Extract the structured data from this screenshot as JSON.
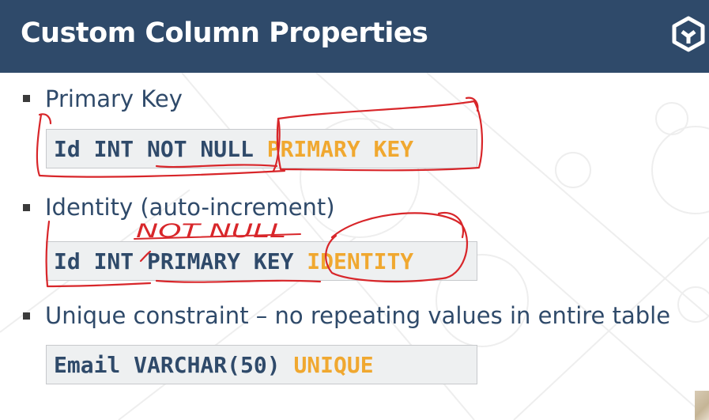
{
  "header": {
    "title": "Custom Column Properties",
    "logo_icon": "academy-logo-icon"
  },
  "bullets": [
    {
      "text": "Primary Key",
      "code_base": "Id INT NOT NULL ",
      "code_keyword": "PRIMARY KEY"
    },
    {
      "text": "Identity (auto-increment)",
      "code_base": "Id INT PRIMARY KEY ",
      "code_keyword": "IDENTITY"
    },
    {
      "text": "Unique constraint – no repeating values in entire table",
      "code_base": "Email VARCHAR(50) ",
      "code_keyword": "UNIQUE"
    }
  ],
  "annotation": {
    "handwritten_text": "NOT NULL"
  },
  "colors": {
    "header": "#2f4a6a",
    "keyword": "#f0a830",
    "ink": "#d8262a",
    "code_bg": "#eef0f1"
  }
}
